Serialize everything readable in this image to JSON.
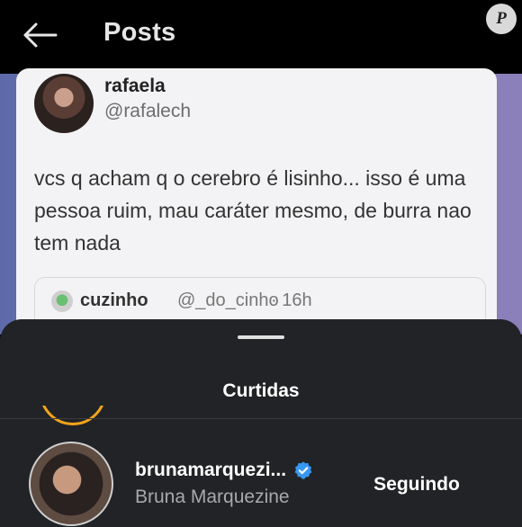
{
  "header": {
    "title": "Posts",
    "back_icon": "arrow-left-icon"
  },
  "watermark": {
    "letter": "P"
  },
  "tweet": {
    "name": "rafaela",
    "handle": "@rafalech",
    "text": "vcs q acham q o cerebro é lisinho... isso é uma pessoa ruim, mau caráter mesmo, de burra nao tem nada",
    "quote": {
      "name": "cuzinho",
      "handle": "@_do_cinho",
      "time": "· 16h"
    }
  },
  "sheet": {
    "title": "Curtidas",
    "likes": [
      {
        "username": "brunamarquezi...",
        "full_name": "Bruna Marquezine",
        "verified": true,
        "button_label": "Seguindo"
      }
    ]
  },
  "colors": {
    "sheet_bg": "#222326",
    "verified_blue": "#3897f0",
    "story_ring": "#f2a41a"
  }
}
